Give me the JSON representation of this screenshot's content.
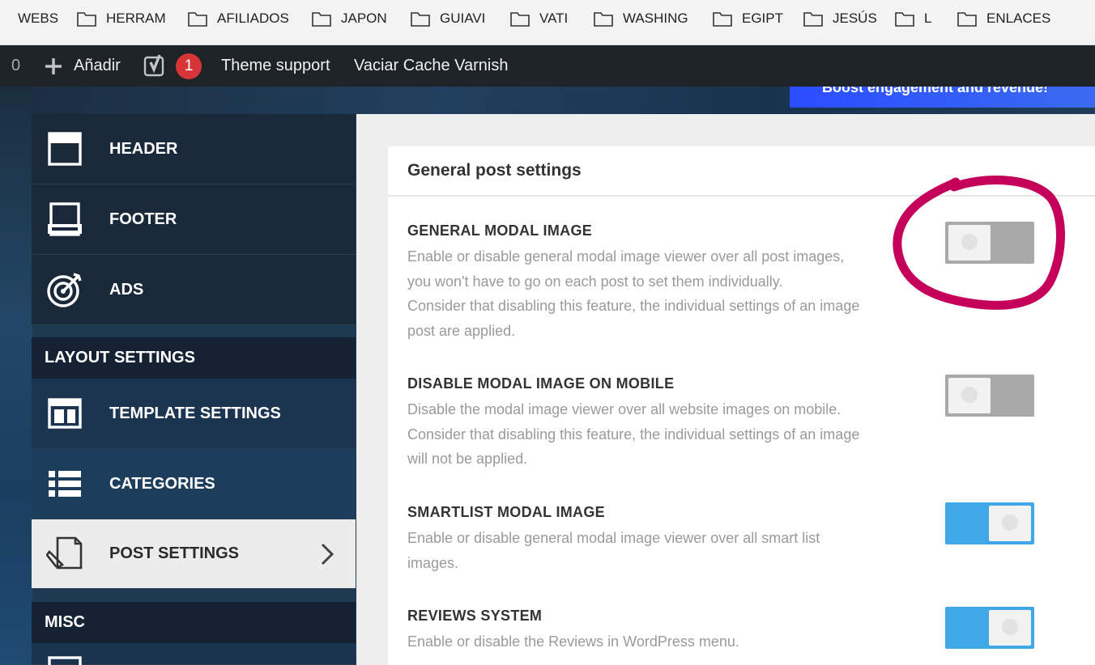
{
  "bookmarks": {
    "first": "WEBS",
    "folders": [
      "HERRAM",
      "AFILIADOS",
      "JAPON",
      "GUIAVI",
      "VATI",
      "WASHING",
      "EGIPT",
      "JESÚS",
      "L",
      "ENLACES"
    ]
  },
  "adminbar": {
    "count": "0",
    "add_label": "Añadir",
    "notification_count": "1",
    "theme_support": "Theme support",
    "varnish": "Vaciar Cache Varnish"
  },
  "promo_text": "Boost engagement and revenue!",
  "sidebar": {
    "header": "HEADER",
    "footer": "FOOTER",
    "ads": "ADS",
    "layout_section": "LAYOUT SETTINGS",
    "template": "TEMPLATE SETTINGS",
    "categories": "CATEGORIES",
    "post_settings": "POST SETTINGS",
    "misc_section": "MISC"
  },
  "panel": {
    "title": "General post settings",
    "settings": [
      {
        "title": "GENERAL MODAL IMAGE",
        "desc": [
          "Enable or disable general modal image viewer over all post images,",
          "you won't have to go on each post to set them individually.",
          "Consider that disabling this feature, the individual settings of an image",
          "post are applied."
        ],
        "enabled": false
      },
      {
        "title": "DISABLE MODAL IMAGE ON MOBILE",
        "desc": [
          "Disable the modal image viewer over all website images on mobile.",
          "Consider that disabling this feature, the individual settings of an image",
          "will not be applied."
        ],
        "enabled": false
      },
      {
        "title": "SMARTLIST MODAL IMAGE",
        "desc": [
          "Enable or disable general modal image viewer over all smart list",
          "images."
        ],
        "enabled": true
      },
      {
        "title": "REVIEWS SYSTEM",
        "desc": [
          "Enable or disable the Reviews in WordPress menu."
        ],
        "enabled": true
      }
    ]
  },
  "colors": {
    "toggle_on": "#41a8e7",
    "toggle_off": "#a9a9a9",
    "annotation": "#c4005a",
    "badge": "#d63638"
  }
}
